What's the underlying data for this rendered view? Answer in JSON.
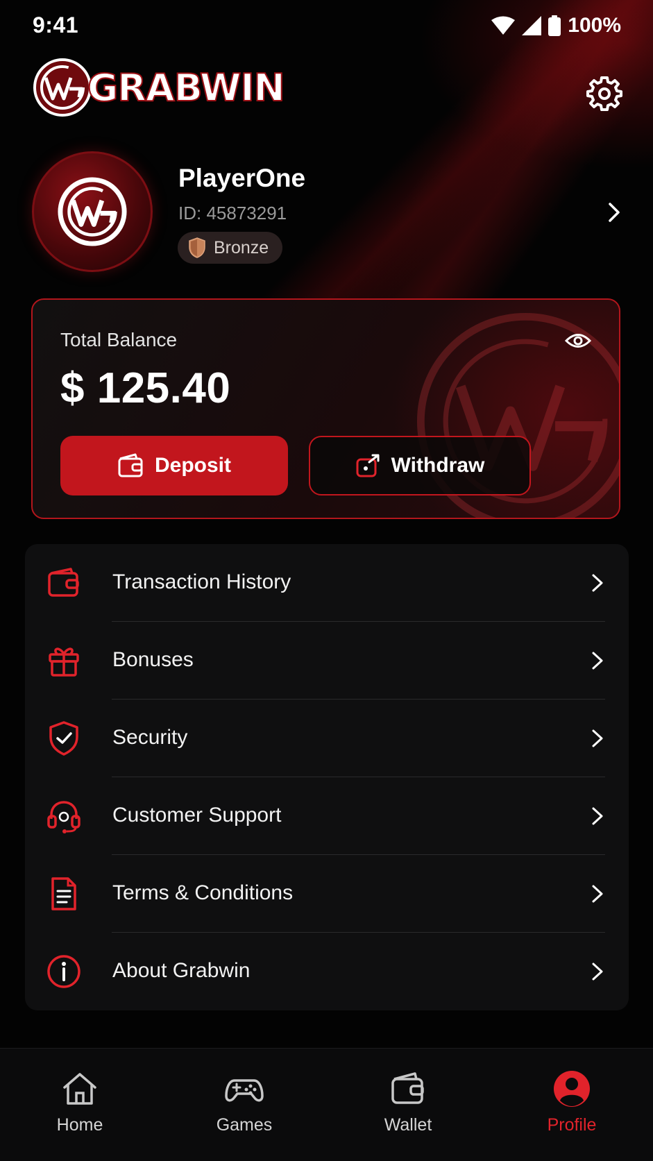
{
  "status_bar": {
    "time": "9:41",
    "battery": "100%"
  },
  "header": {
    "brand": "GRABWIN",
    "icons": [
      "logo-wg",
      "settings-gear-icon"
    ]
  },
  "profile": {
    "username": "PlayerOne",
    "id_text": "ID: 45873291",
    "tier": "Bronze"
  },
  "balance_card": {
    "label": "Total Balance",
    "amount": "$ 125.40",
    "deposit_label": "Deposit",
    "withdraw_label": "Withdraw"
  },
  "menu": {
    "items": [
      {
        "label": "Transaction History",
        "icon": "wallet-icon"
      },
      {
        "label": "Bonuses",
        "icon": "gift-icon"
      },
      {
        "label": "Security",
        "icon": "shield-check-icon"
      },
      {
        "label": "Customer Support",
        "icon": "headset-icon"
      },
      {
        "label": "Terms & Conditions",
        "icon": "document-icon"
      },
      {
        "label": "About Grabwin",
        "icon": "info-icon"
      }
    ]
  },
  "bottom_nav": {
    "tabs": [
      {
        "label": "Home",
        "icon": "home-icon"
      },
      {
        "label": "Games",
        "icon": "gamepad-icon"
      },
      {
        "label": "Wallet",
        "icon": "wallet-icon"
      },
      {
        "label": "Profile",
        "icon": "profile-icon"
      }
    ],
    "active": "Profile"
  },
  "colors": {
    "accent": "#c2161d",
    "background": "#030303",
    "card": "#0f0f10",
    "muted": "#9a9a9a"
  }
}
